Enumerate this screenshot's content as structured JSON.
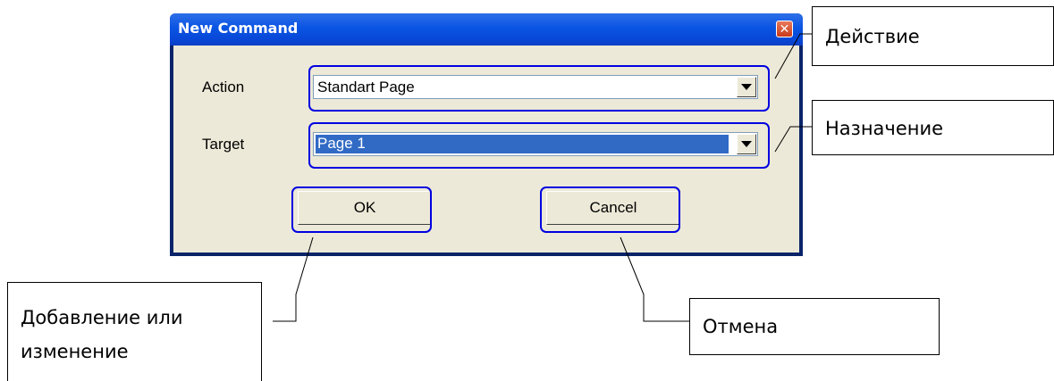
{
  "dialog": {
    "title": "New Command",
    "close_glyph": "✕",
    "action_label": "Action",
    "action_value": "Standart Page",
    "target_label": "Target",
    "target_value": "Page 1",
    "ok_label": "OK",
    "cancel_label": "Cancel"
  },
  "callouts": {
    "action": "Действие",
    "target": "Назначение",
    "ok_line1": "Добавление или",
    "ok_line2": "изменение",
    "cancel": "Отмена"
  },
  "icons": {
    "close": "close-icon",
    "dropdown": "dropdown-arrow-icon"
  },
  "colors": {
    "highlight": "#0000e0",
    "titlebar": "#0a54e3",
    "selection": "#316ac5",
    "dialog_bg": "#ece9d8"
  }
}
